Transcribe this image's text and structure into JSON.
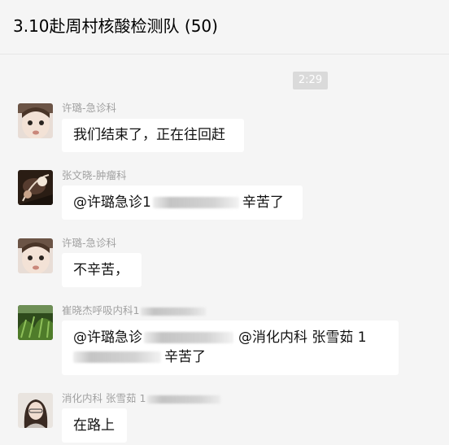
{
  "chat": {
    "title": "3.10赴周村核酸检测队 (50)",
    "timestamp": "2:29"
  },
  "messages": [
    {
      "sender": "许璐-急诊科",
      "text": "我们结束了，正在往回赶"
    },
    {
      "sender": "张文晓-肿瘤科",
      "mention": "@许璐急诊1",
      "tail": "辛苦了"
    },
    {
      "sender": "许璐-急诊科",
      "text": "不辛苦，"
    },
    {
      "sender": "崔晓杰呼吸内科1",
      "line1_mention": "@许璐急诊",
      "line1_mention2": "@消化内科  张雪茹 1",
      "line2_tail": "辛苦了"
    },
    {
      "sender": "消化内科  张雪茹 1",
      "text": "在路上"
    }
  ]
}
